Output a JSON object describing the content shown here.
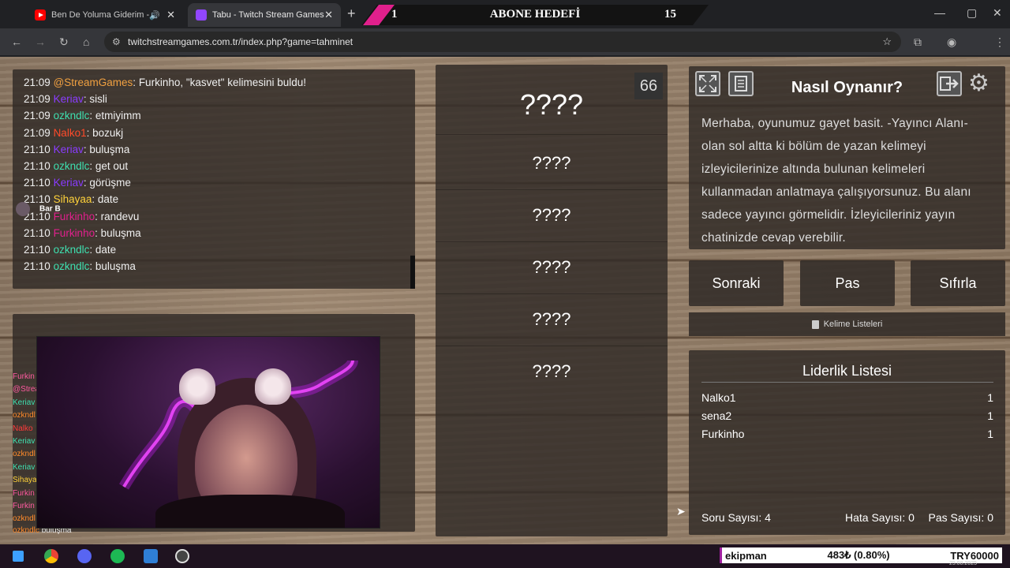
{
  "browser": {
    "tabs": [
      {
        "title": "Ben De Yoluma Giderim - Y",
        "favicon": "youtube-icon",
        "active": false
      },
      {
        "title": "Tabu - Twitch Stream Games",
        "favicon": "twitch-icon",
        "active": true
      }
    ],
    "url": "twitchstreamgames.com.tr/index.php?game=tahminet"
  },
  "sub_goal": {
    "current": "1",
    "label": "ABONE HEDEFİ",
    "target": "15"
  },
  "chat": {
    "messages": [
      {
        "time": "21:09",
        "user": "@StreamGames",
        "sep": ":",
        "text": " Furkinho, \"kasvet\" kelimesini buldu!",
        "color": "#f0a040"
      },
      {
        "time": "21:09",
        "user": "Keriav",
        "sep": ":",
        "text": " sisli",
        "color": "#8a3cff"
      },
      {
        "time": "21:09",
        "user": "ozkndlc",
        "sep": ":",
        "text": " etmiyimm",
        "color": "#3ee0b0"
      },
      {
        "time": "21:09",
        "user": "Nalko1",
        "sep": ":",
        "text": " bozukj",
        "color": "#ff4a2a"
      },
      {
        "time": "21:10",
        "user": "Keriav",
        "sep": ":",
        "text": " buluşma",
        "color": "#8a3cff"
      },
      {
        "time": "21:10",
        "user": "ozkndlc",
        "sep": ":",
        "text": " get out",
        "color": "#3ee0b0"
      },
      {
        "time": "21:10",
        "user": "Keriav",
        "sep": ":",
        "text": " görüşme",
        "color": "#8a3cff"
      },
      {
        "time": "21:10",
        "user": "Sihayaa",
        "sep": ":",
        "text": " date",
        "color": "#ffd23a"
      },
      {
        "time": "21:10",
        "user": "Furkinho",
        "sep": ":",
        "text": " randevu",
        "color": "#e0208c"
      },
      {
        "time": "21:10",
        "user": "Furkinho",
        "sep": ":",
        "text": " buluşma",
        "color": "#e0208c"
      },
      {
        "time": "21:10",
        "user": "ozkndlc",
        "sep": ":",
        "text": " date",
        "color": "#3ee0b0"
      },
      {
        "time": "21:10",
        "user": "ozkndlc",
        "sep": ":",
        "text": " buluşma",
        "color": "#3ee0b0"
      }
    ],
    "overlay_user": "Bar B"
  },
  "side_chat": {
    "names": [
      {
        "name": "Furkin",
        "color": "#ff5aa0"
      },
      {
        "name": "@Strea",
        "color": "#ff5aa0"
      },
      {
        "name": "Keriav",
        "color": "#3ee0b0"
      },
      {
        "name": "ozkndl",
        "color": "#ff8a2a"
      },
      {
        "name": "Nalko",
        "color": "#ff3a3a"
      },
      {
        "name": "Keriav",
        "color": "#3ee0b0"
      },
      {
        "name": "ozkndl",
        "color": "#ff8a2a"
      },
      {
        "name": "Keriav",
        "color": "#3ee0b0"
      },
      {
        "name": "Sihaya",
        "color": "#ffd23a"
      },
      {
        "name": "Furkin",
        "color": "#ff5aa0"
      },
      {
        "name": "Furkin",
        "color": "#ff5aa0"
      },
      {
        "name": "ozkndl",
        "color": "#ff8a2a"
      }
    ],
    "last_user": "ozkndlc",
    "last_text": "buluşma"
  },
  "game": {
    "timer": "66",
    "main_word": "????",
    "taboo_words": [
      "????",
      "????",
      "????",
      "????",
      "????"
    ]
  },
  "howto": {
    "title": "Nasıl Oynanır?",
    "body": "Merhaba, oyunumuz gayet basit. -Yayıncı Alanı- olan sol altta ki bölüm de yazan kelimeyi izleyicilerinize altında bulunan kelimeleri kullanmadan anlatmaya çalışıyorsunuz. Bu alanı sadece yayıncı görmelidir. İzleyicileriniz yayın chatinizde cevap verebilir."
  },
  "buttons": {
    "next": "Sonraki",
    "pass": "Pas",
    "reset": "Sıfırla",
    "word_lists": "Kelime Listeleri"
  },
  "leaderboard": {
    "title": "Liderlik Listesi",
    "rows": [
      {
        "name": "Nalko1",
        "score": "1"
      },
      {
        "name": "sena2",
        "score": "1"
      },
      {
        "name": "Furkinho",
        "score": "1"
      }
    ],
    "stats": {
      "questions": "Soru Sayısı: 4",
      "errors": "Hata Sayısı: 0",
      "passes": "Pas Sayısı: 0"
    }
  },
  "ticker": {
    "name": "ekipman",
    "change": "483₺ (0.80%)",
    "target": "TRY60000"
  },
  "taskbar": {
    "date": "29.08.2025"
  }
}
